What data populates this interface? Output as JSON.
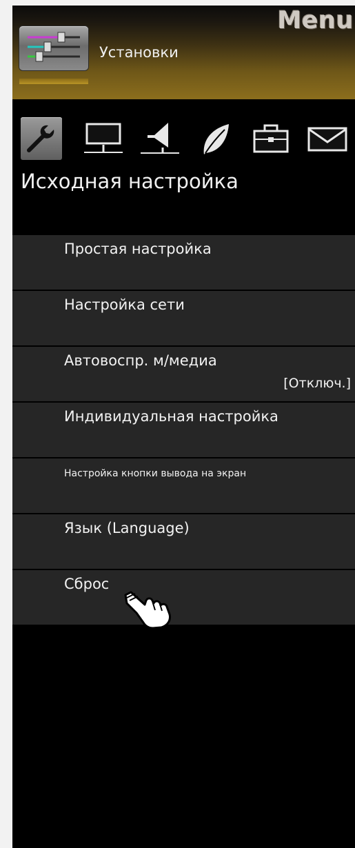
{
  "header": {
    "menu_title": "Menu",
    "category_label": "Установки",
    "category_icon": "sliders-icon"
  },
  "category_icons": [
    {
      "name": "wrench-icon",
      "selected": true
    },
    {
      "name": "monitor-icon",
      "selected": false
    },
    {
      "name": "speaker-icon",
      "selected": false
    },
    {
      "name": "leaf-icon",
      "selected": false
    },
    {
      "name": "toolbox-icon",
      "selected": false
    },
    {
      "name": "envelope-icon",
      "selected": false
    }
  ],
  "section": {
    "title": "Исходная настройка"
  },
  "menu_items": [
    {
      "label": "Простая настройка"
    },
    {
      "label": "Настройка сети"
    },
    {
      "label": "Автовоспр. м/медиа",
      "value": "[Отключ.]"
    },
    {
      "label": "Индивидуальная настройка"
    },
    {
      "label": "Настройка кнопки вывода на экран"
    },
    {
      "label": "Язык (Language)"
    },
    {
      "label": "Сброс"
    }
  ],
  "cursor": {
    "icon": "hand-pointer-icon"
  },
  "colors": {
    "background": "#000000",
    "header_gold": "#8c6e1d",
    "item_bg": "#262626",
    "text": "#f2f2f2"
  }
}
